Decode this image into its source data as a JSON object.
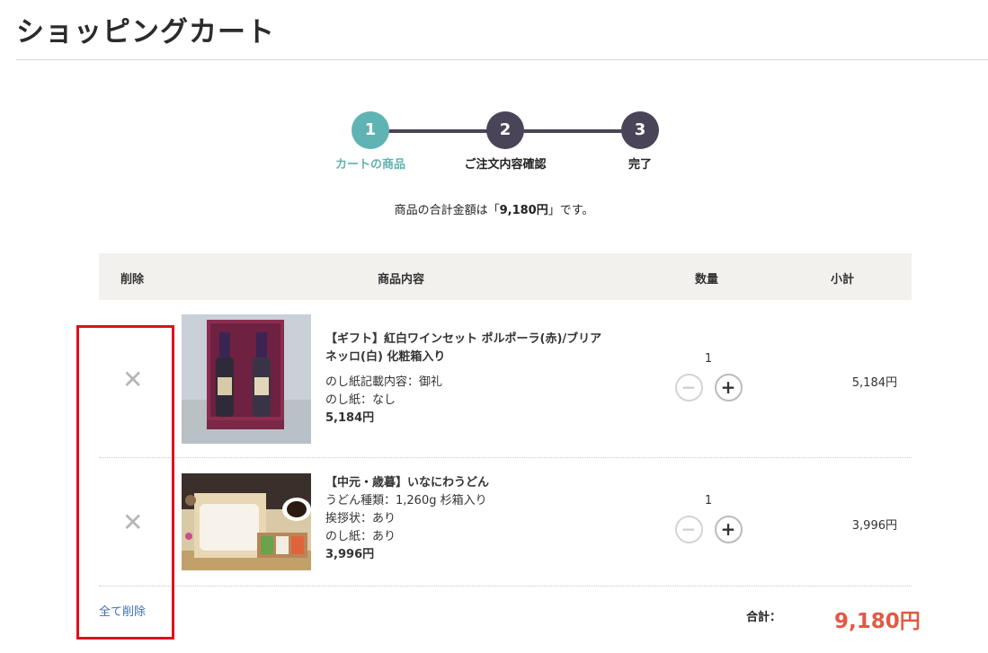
{
  "page": {
    "title": "ショッピングカート"
  },
  "stepper": {
    "steps": [
      {
        "number": "1",
        "label": "カートの商品",
        "active": true
      },
      {
        "number": "2",
        "label": "ご注文内容確認",
        "active": false
      },
      {
        "number": "3",
        "label": "完了",
        "active": false
      }
    ]
  },
  "summary": {
    "prefix": "商品の合計金額は「",
    "amount": "9,180円",
    "suffix": "」です。"
  },
  "table": {
    "headers": {
      "delete": "削除",
      "description": "商品内容",
      "quantity": "数量",
      "subtotal": "小計"
    },
    "items": [
      {
        "remove": "✕",
        "name_line1": "【ギフト】紅白ワインセット ポルポーラ(赤)/ブリア",
        "name_line2": "ネッロ(白) 化粧箱入り",
        "options": [
          "のし紙記載内容：御礼",
          "のし紙：なし"
        ],
        "price": "5,184円",
        "quantity": "1",
        "minus": "−",
        "plus": "+",
        "subtotal": "5,184円"
      },
      {
        "remove": "✕",
        "name_line1": "【中元・歳暮】いなにわうどん",
        "name_line2": "",
        "options": [
          "うどん種類：1,260g 杉箱入り",
          "挨拶状：あり",
          "のし紙：あり"
        ],
        "price": "3,996円",
        "quantity": "1",
        "minus": "−",
        "plus": "+",
        "subtotal": "3,996円"
      }
    ]
  },
  "footer": {
    "delete_all": "全て削除",
    "total_label": "合計：",
    "total_value": "9,180円"
  },
  "colors": {
    "accent_teal": "#5fb3b3",
    "step_dark": "#4a4458",
    "total_red": "#e05a46",
    "link_blue": "#3c6fb5",
    "highlight_red": "#e0101c"
  }
}
